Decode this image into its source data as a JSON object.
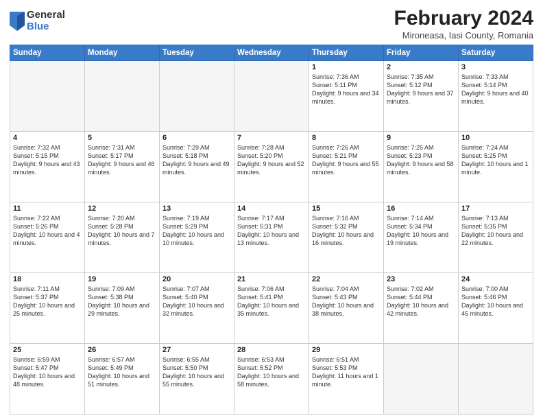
{
  "logo": {
    "general": "General",
    "blue": "Blue"
  },
  "title": "February 2024",
  "subtitle": "Mironeasa, Iasi County, Romania",
  "days_of_week": [
    "Sunday",
    "Monday",
    "Tuesday",
    "Wednesday",
    "Thursday",
    "Friday",
    "Saturday"
  ],
  "weeks": [
    [
      {
        "day": "",
        "info": ""
      },
      {
        "day": "",
        "info": ""
      },
      {
        "day": "",
        "info": ""
      },
      {
        "day": "",
        "info": ""
      },
      {
        "day": "1",
        "info": "Sunrise: 7:36 AM\nSunset: 5:11 PM\nDaylight: 9 hours and 34 minutes."
      },
      {
        "day": "2",
        "info": "Sunrise: 7:35 AM\nSunset: 5:12 PM\nDaylight: 9 hours and 37 minutes."
      },
      {
        "day": "3",
        "info": "Sunrise: 7:33 AM\nSunset: 5:14 PM\nDaylight: 9 hours and 40 minutes."
      }
    ],
    [
      {
        "day": "4",
        "info": "Sunrise: 7:32 AM\nSunset: 5:15 PM\nDaylight: 9 hours and 43 minutes."
      },
      {
        "day": "5",
        "info": "Sunrise: 7:31 AM\nSunset: 5:17 PM\nDaylight: 9 hours and 46 minutes."
      },
      {
        "day": "6",
        "info": "Sunrise: 7:29 AM\nSunset: 5:18 PM\nDaylight: 9 hours and 49 minutes."
      },
      {
        "day": "7",
        "info": "Sunrise: 7:28 AM\nSunset: 5:20 PM\nDaylight: 9 hours and 52 minutes."
      },
      {
        "day": "8",
        "info": "Sunrise: 7:26 AM\nSunset: 5:21 PM\nDaylight: 9 hours and 55 minutes."
      },
      {
        "day": "9",
        "info": "Sunrise: 7:25 AM\nSunset: 5:23 PM\nDaylight: 9 hours and 58 minutes."
      },
      {
        "day": "10",
        "info": "Sunrise: 7:24 AM\nSunset: 5:25 PM\nDaylight: 10 hours and 1 minute."
      }
    ],
    [
      {
        "day": "11",
        "info": "Sunrise: 7:22 AM\nSunset: 5:26 PM\nDaylight: 10 hours and 4 minutes."
      },
      {
        "day": "12",
        "info": "Sunrise: 7:20 AM\nSunset: 5:28 PM\nDaylight: 10 hours and 7 minutes."
      },
      {
        "day": "13",
        "info": "Sunrise: 7:19 AM\nSunset: 5:29 PM\nDaylight: 10 hours and 10 minutes."
      },
      {
        "day": "14",
        "info": "Sunrise: 7:17 AM\nSunset: 5:31 PM\nDaylight: 10 hours and 13 minutes."
      },
      {
        "day": "15",
        "info": "Sunrise: 7:16 AM\nSunset: 5:32 PM\nDaylight: 10 hours and 16 minutes."
      },
      {
        "day": "16",
        "info": "Sunrise: 7:14 AM\nSunset: 5:34 PM\nDaylight: 10 hours and 19 minutes."
      },
      {
        "day": "17",
        "info": "Sunrise: 7:13 AM\nSunset: 5:35 PM\nDaylight: 10 hours and 22 minutes."
      }
    ],
    [
      {
        "day": "18",
        "info": "Sunrise: 7:11 AM\nSunset: 5:37 PM\nDaylight: 10 hours and 25 minutes."
      },
      {
        "day": "19",
        "info": "Sunrise: 7:09 AM\nSunset: 5:38 PM\nDaylight: 10 hours and 29 minutes."
      },
      {
        "day": "20",
        "info": "Sunrise: 7:07 AM\nSunset: 5:40 PM\nDaylight: 10 hours and 32 minutes."
      },
      {
        "day": "21",
        "info": "Sunrise: 7:06 AM\nSunset: 5:41 PM\nDaylight: 10 hours and 35 minutes."
      },
      {
        "day": "22",
        "info": "Sunrise: 7:04 AM\nSunset: 5:43 PM\nDaylight: 10 hours and 38 minutes."
      },
      {
        "day": "23",
        "info": "Sunrise: 7:02 AM\nSunset: 5:44 PM\nDaylight: 10 hours and 42 minutes."
      },
      {
        "day": "24",
        "info": "Sunrise: 7:00 AM\nSunset: 5:46 PM\nDaylight: 10 hours and 45 minutes."
      }
    ],
    [
      {
        "day": "25",
        "info": "Sunrise: 6:59 AM\nSunset: 5:47 PM\nDaylight: 10 hours and 48 minutes."
      },
      {
        "day": "26",
        "info": "Sunrise: 6:57 AM\nSunset: 5:49 PM\nDaylight: 10 hours and 51 minutes."
      },
      {
        "day": "27",
        "info": "Sunrise: 6:55 AM\nSunset: 5:50 PM\nDaylight: 10 hours and 55 minutes."
      },
      {
        "day": "28",
        "info": "Sunrise: 6:53 AM\nSunset: 5:52 PM\nDaylight: 10 hours and 58 minutes."
      },
      {
        "day": "29",
        "info": "Sunrise: 6:51 AM\nSunset: 5:53 PM\nDaylight: 11 hours and 1 minute."
      },
      {
        "day": "",
        "info": ""
      },
      {
        "day": "",
        "info": ""
      }
    ]
  ]
}
